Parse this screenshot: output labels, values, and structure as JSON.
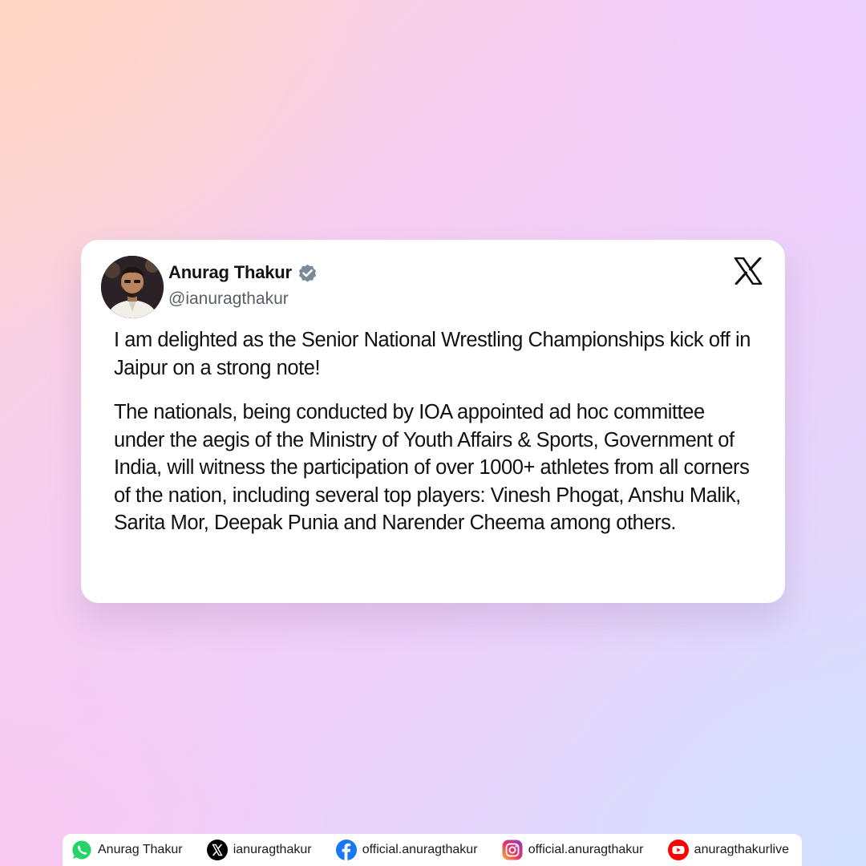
{
  "tweet": {
    "author_name": "Anurag Thakur",
    "author_handle": "@ianuragthakur",
    "platform_icon": "x-logo-icon",
    "verified_badge_icon": "verified-badge-icon",
    "paragraphs": [
      "I am delighted as the Senior National Wrestling Championships kick off in Jaipur on a strong note!",
      "The nationals, being conducted by IOA appointed ad hoc committee under the aegis of the Ministry of Youth Affairs & Sports, Government of India, will witness the participation of over 1000+ athletes from all corners of the nation, including several top players: Vinesh Phogat, Anshu Malik, Sarita Mor, Deepak Punia and Narender Cheema among others."
    ]
  },
  "footer": {
    "links": [
      {
        "icon": "whatsapp-icon",
        "label": "Anurag Thakur",
        "color": "#25d366"
      },
      {
        "icon": "x-icon",
        "label": "ianuragthakur",
        "color": "#000000"
      },
      {
        "icon": "facebook-icon",
        "label": "official.anuragthakur",
        "color": "#1877f2"
      },
      {
        "icon": "instagram-icon",
        "label": "official.anuragthakur",
        "color": "#d6249f"
      },
      {
        "icon": "youtube-icon",
        "label": "anuragthakurlive",
        "color": "#ff0000"
      }
    ]
  },
  "colors": {
    "card_background": "#ffffff",
    "text_primary": "#111111",
    "handle_text": "#5a5f66",
    "verified_badge": "#7d8b99"
  }
}
